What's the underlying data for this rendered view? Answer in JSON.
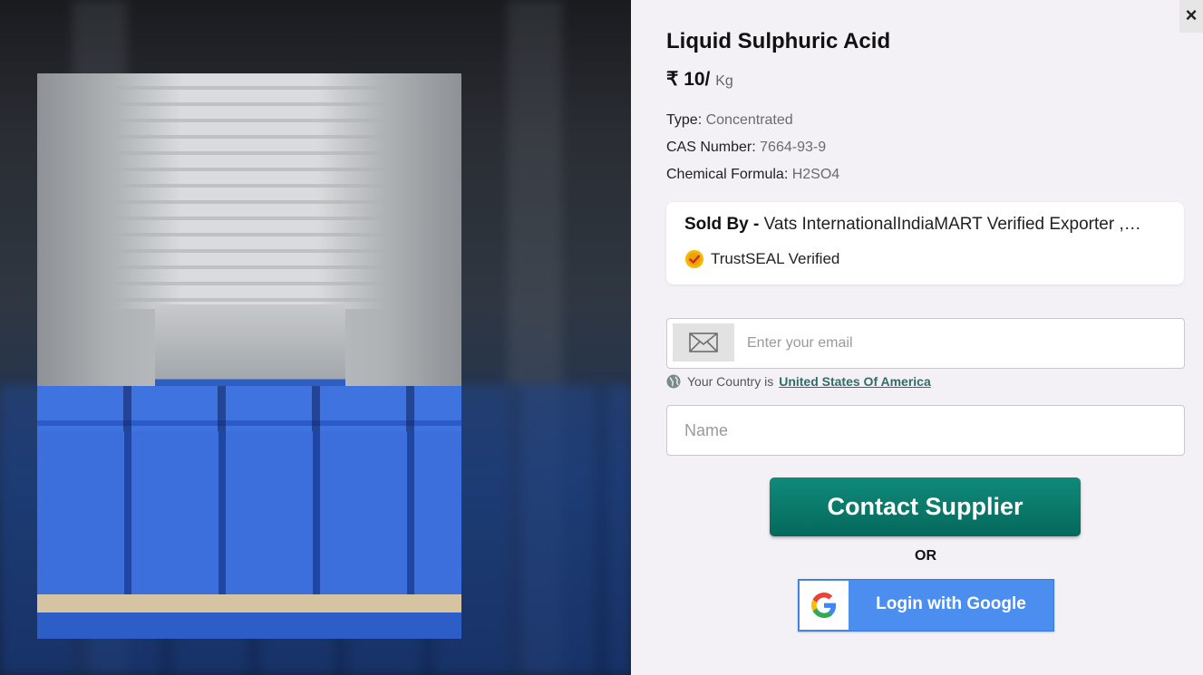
{
  "product": {
    "title": "Liquid Sulphuric Acid",
    "price_value": "₹ 10/",
    "price_unit": "Kg",
    "specs": [
      {
        "label": "Type:",
        "value": "Concentrated"
      },
      {
        "label": "CAS Number:",
        "value": "7664-93-9"
      },
      {
        "label": "Chemical Formula:",
        "value": "H2SO4"
      }
    ],
    "image_icon": "product-photo-blue-jerrycans"
  },
  "seller": {
    "sold_by_label": "Sold By -",
    "name": "Vats InternationalIndiaMART Verified Exporter ,…",
    "trust_label": "TrustSEAL Verified"
  },
  "form": {
    "email_placeholder": "Enter your email",
    "country_prefix": "Your Country is",
    "country_name": "United States Of America",
    "name_placeholder": "Name",
    "contact_label": "Contact Supplier",
    "or_label": "OR",
    "google_label": "Login with Google"
  },
  "dialog": {
    "close_label": "×"
  },
  "colors": {
    "accent_green": "#05695c",
    "google_blue": "#4c8ef0",
    "country_link": "#2f6d6b",
    "panel_bg": "#f3f1f5"
  }
}
